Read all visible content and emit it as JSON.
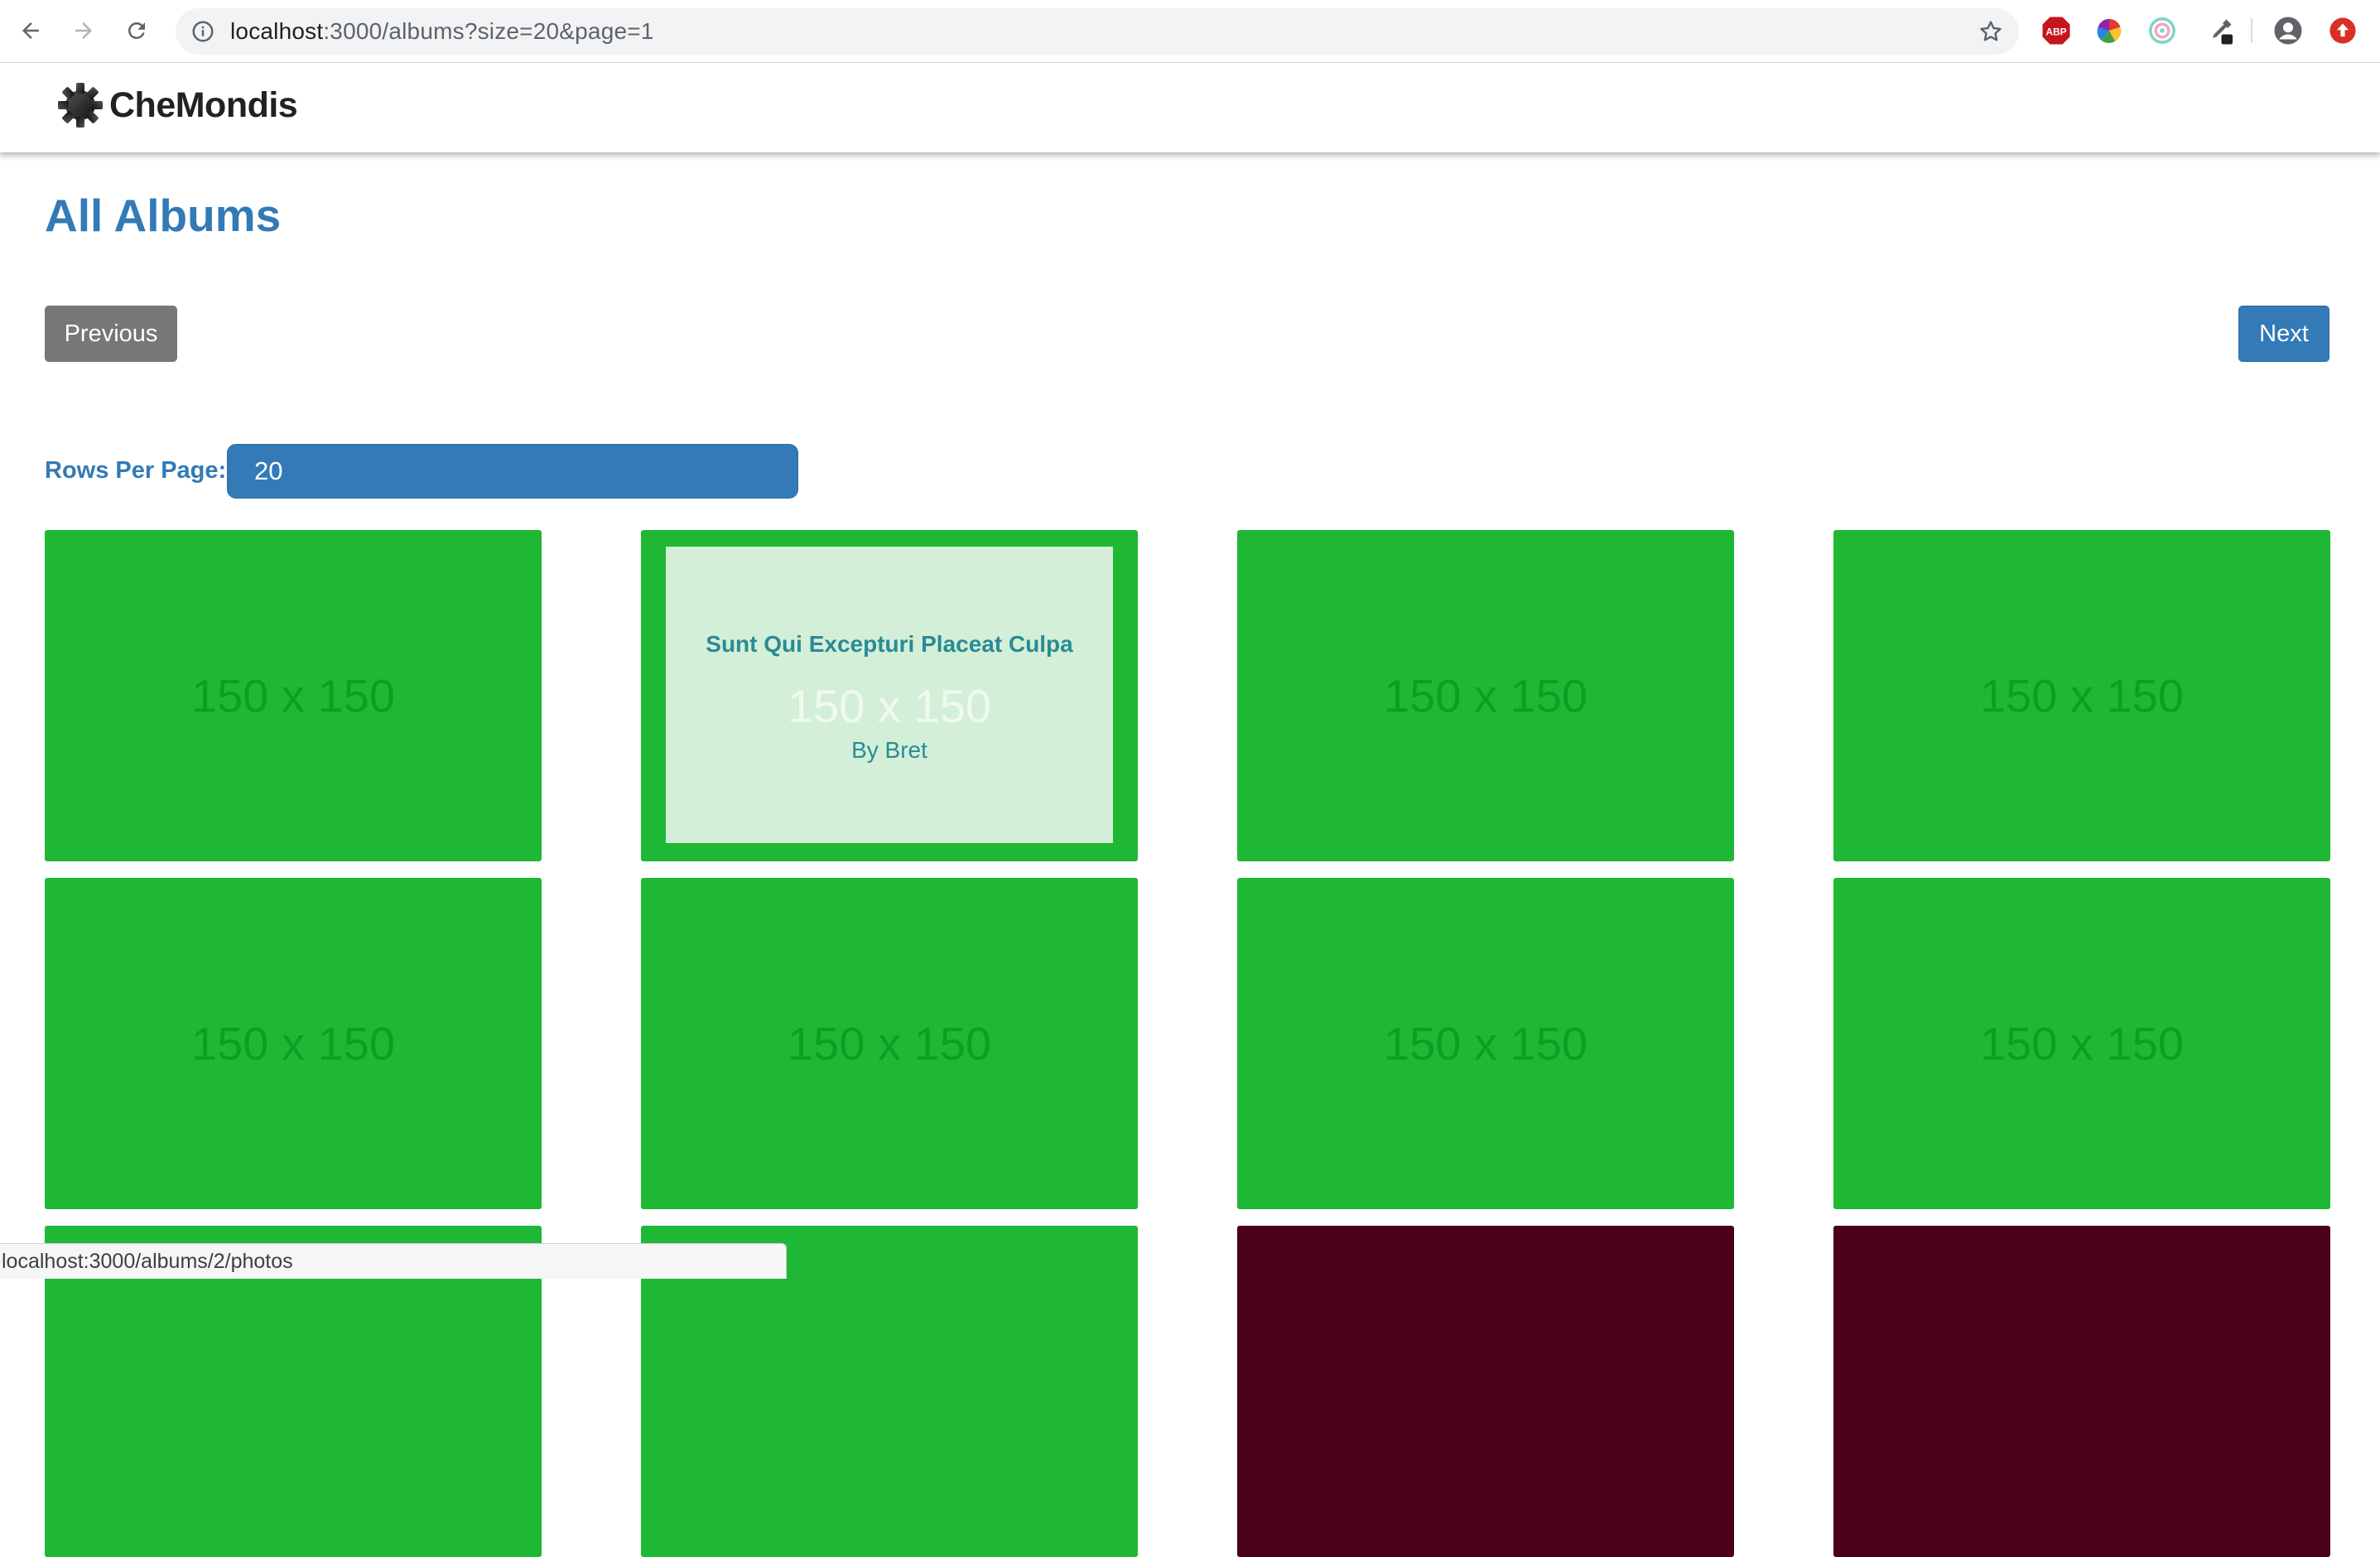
{
  "browser": {
    "url_host": "localhost",
    "url_rest": ":3000/albums?size=20&page=1"
  },
  "app": {
    "brand": "CheMondis"
  },
  "page": {
    "title": "All Albums",
    "previous_label": "Previous",
    "next_label": "Next",
    "rows_per_page_label": "Rows Per Page:",
    "rows_per_page_value": "20"
  },
  "albums": [
    {
      "placeholder": "150 x 150"
    },
    {
      "placeholder": "150 x 150",
      "title": "Sunt Qui Excepturi Placeat Culpa",
      "author": "By Bret"
    },
    {
      "placeholder": "150 x 150"
    },
    {
      "placeholder": "150 x 150"
    },
    {
      "placeholder": "150 x 150"
    },
    {
      "placeholder": "150 x 150"
    },
    {
      "placeholder": "150 x 150"
    },
    {
      "placeholder": "150 x 150"
    }
  ],
  "status_url": "localhost:3000/albums/2/photos",
  "colors": {
    "accent": "#337ab7",
    "card_green": "#1fb834",
    "card_dark": "#4a0118",
    "previous_button": "#777777"
  }
}
